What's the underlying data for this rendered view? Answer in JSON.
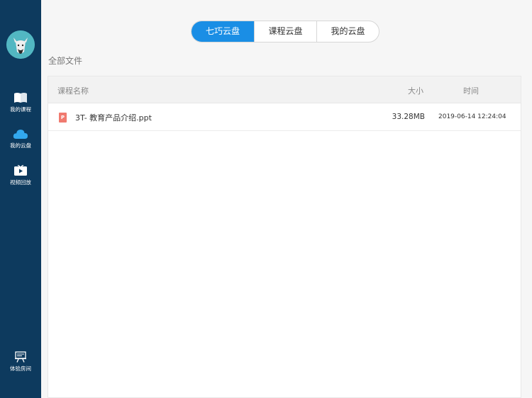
{
  "sidebar": {
    "items": [
      {
        "label": "我的课程",
        "icon": "book-icon"
      },
      {
        "label": "我的云盘",
        "icon": "cloud-icon"
      },
      {
        "label": "视频回放",
        "icon": "video-play-icon"
      }
    ],
    "bottom": {
      "label": "体验房间",
      "icon": "presentation-board-icon"
    },
    "colors": {
      "background": "#0d3a5e",
      "avatar": "#52b7c2"
    }
  },
  "tabs": [
    {
      "label": "七巧云盘",
      "active": true
    },
    {
      "label": "课程云盘",
      "active": false
    },
    {
      "label": "我的云盘",
      "active": false
    }
  ],
  "breadcrumb": "全部文件",
  "table": {
    "headers": {
      "name": "课程名称",
      "size": "大小",
      "time": "时间"
    },
    "rows": [
      {
        "icon": "ppt-file-icon",
        "icon_letter": "P",
        "name": "3T- 教育产品介绍.ppt",
        "size": "33.28MB",
        "time": "2019-06-14 12:24:04"
      }
    ]
  },
  "accent_color": "#1a8ee5"
}
